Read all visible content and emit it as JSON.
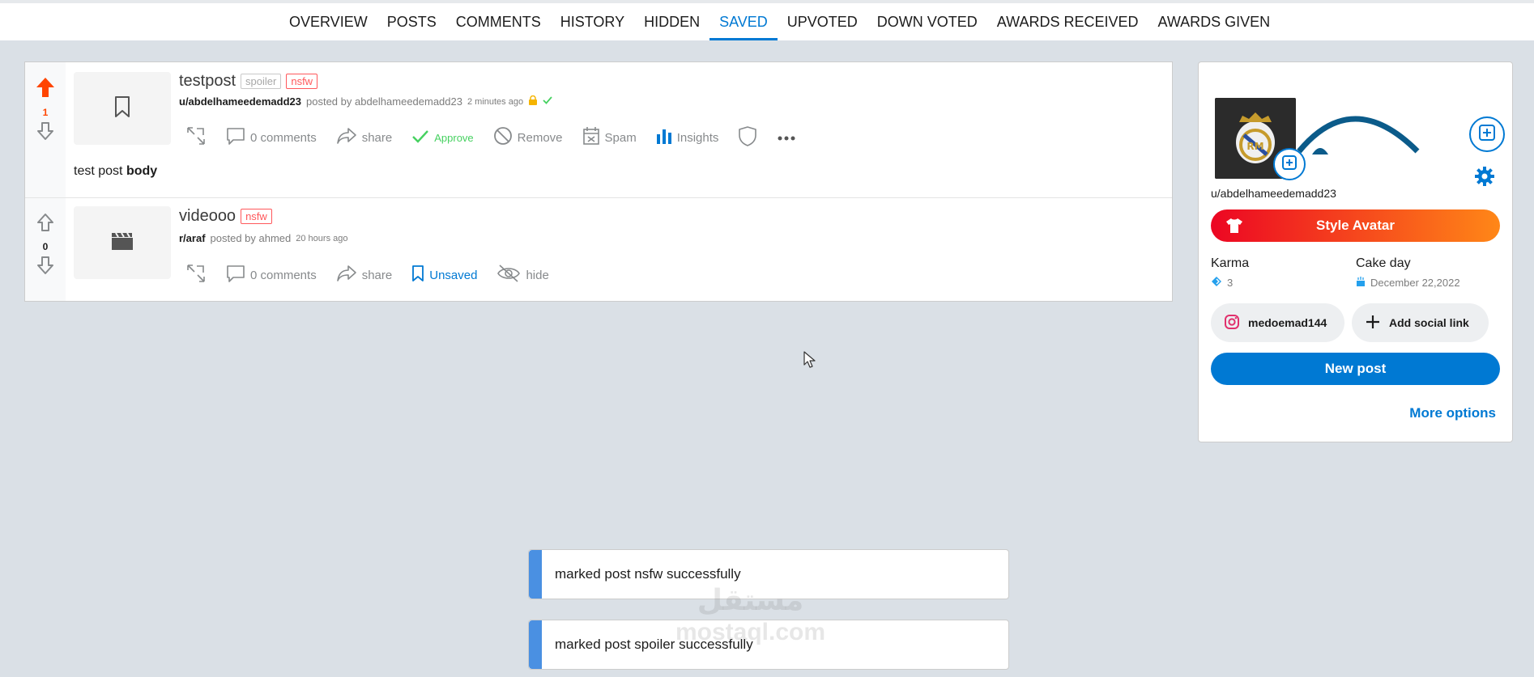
{
  "tabs": [
    {
      "label": "OVERVIEW",
      "active": false
    },
    {
      "label": "POSTS",
      "active": false
    },
    {
      "label": "COMMENTS",
      "active": false
    },
    {
      "label": "HISTORY",
      "active": false
    },
    {
      "label": "HIDDEN",
      "active": false
    },
    {
      "label": "SAVED",
      "active": true
    },
    {
      "label": "UPVOTED",
      "active": false
    },
    {
      "label": "DOWN VOTED",
      "active": false
    },
    {
      "label": "AWARDS RECEIVED",
      "active": false
    },
    {
      "label": "AWARDS GIVEN",
      "active": false
    }
  ],
  "posts": [
    {
      "score": "1",
      "title": "testpost",
      "tag_spoiler": "spoiler",
      "tag_nsfw": "nsfw",
      "author": "u/abdelhameedemadd23",
      "posted_by": "posted by abdelhameedemadd23",
      "ago": "2 minutes ago",
      "comments": "0 comments",
      "share": "share",
      "approve": "Approve",
      "remove": "Remove",
      "spam": "Spam",
      "insights": "Insights",
      "body_prefix": "test post",
      "body_bold": "body"
    },
    {
      "score": "0",
      "title": "videooo",
      "tag_nsfw": "nsfw",
      "author": "r/araf",
      "posted_by": "posted by ahmed",
      "ago": "20 hours ago",
      "comments": "0 comments",
      "share": "share",
      "unsaved": "Unsaved",
      "hide": "hide"
    }
  ],
  "profile": {
    "username": "u/abdelhameedemadd23",
    "style_avatar": "Style Avatar",
    "karma_label": "Karma",
    "karma_value": "3",
    "cakeday_label": "Cake day",
    "cakeday_value": "December 22,2022",
    "instagram": "medoemad144",
    "add_social": "Add social link",
    "new_post": "New post",
    "more_options": "More options"
  },
  "toasts": [
    "marked post nsfw successfully",
    "marked post spoiler successfully"
  ],
  "watermark": {
    "arabic": "مستقل",
    "latin": "mostaql.com"
  },
  "colors": {
    "accent": "#0079d3",
    "upvote": "#ff4500",
    "nsfw": "#ff585b",
    "approve": "#46d160",
    "toast_bar": "#4a90e2"
  }
}
